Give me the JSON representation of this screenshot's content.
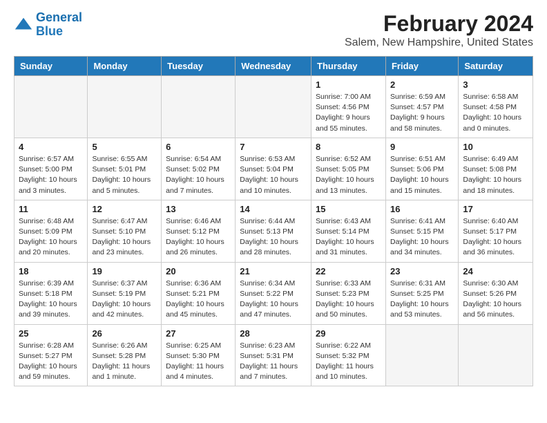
{
  "header": {
    "logo_line1": "General",
    "logo_line2": "Blue",
    "month": "February 2024",
    "location": "Salem, New Hampshire, United States"
  },
  "days_of_week": [
    "Sunday",
    "Monday",
    "Tuesday",
    "Wednesday",
    "Thursday",
    "Friday",
    "Saturday"
  ],
  "weeks": [
    [
      {
        "day": "",
        "info": ""
      },
      {
        "day": "",
        "info": ""
      },
      {
        "day": "",
        "info": ""
      },
      {
        "day": "",
        "info": ""
      },
      {
        "day": "1",
        "info": "Sunrise: 7:00 AM\nSunset: 4:56 PM\nDaylight: 9 hours and 55 minutes."
      },
      {
        "day": "2",
        "info": "Sunrise: 6:59 AM\nSunset: 4:57 PM\nDaylight: 9 hours and 58 minutes."
      },
      {
        "day": "3",
        "info": "Sunrise: 6:58 AM\nSunset: 4:58 PM\nDaylight: 10 hours and 0 minutes."
      }
    ],
    [
      {
        "day": "4",
        "info": "Sunrise: 6:57 AM\nSunset: 5:00 PM\nDaylight: 10 hours and 3 minutes."
      },
      {
        "day": "5",
        "info": "Sunrise: 6:55 AM\nSunset: 5:01 PM\nDaylight: 10 hours and 5 minutes."
      },
      {
        "day": "6",
        "info": "Sunrise: 6:54 AM\nSunset: 5:02 PM\nDaylight: 10 hours and 7 minutes."
      },
      {
        "day": "7",
        "info": "Sunrise: 6:53 AM\nSunset: 5:04 PM\nDaylight: 10 hours and 10 minutes."
      },
      {
        "day": "8",
        "info": "Sunrise: 6:52 AM\nSunset: 5:05 PM\nDaylight: 10 hours and 13 minutes."
      },
      {
        "day": "9",
        "info": "Sunrise: 6:51 AM\nSunset: 5:06 PM\nDaylight: 10 hours and 15 minutes."
      },
      {
        "day": "10",
        "info": "Sunrise: 6:49 AM\nSunset: 5:08 PM\nDaylight: 10 hours and 18 minutes."
      }
    ],
    [
      {
        "day": "11",
        "info": "Sunrise: 6:48 AM\nSunset: 5:09 PM\nDaylight: 10 hours and 20 minutes."
      },
      {
        "day": "12",
        "info": "Sunrise: 6:47 AM\nSunset: 5:10 PM\nDaylight: 10 hours and 23 minutes."
      },
      {
        "day": "13",
        "info": "Sunrise: 6:46 AM\nSunset: 5:12 PM\nDaylight: 10 hours and 26 minutes."
      },
      {
        "day": "14",
        "info": "Sunrise: 6:44 AM\nSunset: 5:13 PM\nDaylight: 10 hours and 28 minutes."
      },
      {
        "day": "15",
        "info": "Sunrise: 6:43 AM\nSunset: 5:14 PM\nDaylight: 10 hours and 31 minutes."
      },
      {
        "day": "16",
        "info": "Sunrise: 6:41 AM\nSunset: 5:15 PM\nDaylight: 10 hours and 34 minutes."
      },
      {
        "day": "17",
        "info": "Sunrise: 6:40 AM\nSunset: 5:17 PM\nDaylight: 10 hours and 36 minutes."
      }
    ],
    [
      {
        "day": "18",
        "info": "Sunrise: 6:39 AM\nSunset: 5:18 PM\nDaylight: 10 hours and 39 minutes."
      },
      {
        "day": "19",
        "info": "Sunrise: 6:37 AM\nSunset: 5:19 PM\nDaylight: 10 hours and 42 minutes."
      },
      {
        "day": "20",
        "info": "Sunrise: 6:36 AM\nSunset: 5:21 PM\nDaylight: 10 hours and 45 minutes."
      },
      {
        "day": "21",
        "info": "Sunrise: 6:34 AM\nSunset: 5:22 PM\nDaylight: 10 hours and 47 minutes."
      },
      {
        "day": "22",
        "info": "Sunrise: 6:33 AM\nSunset: 5:23 PM\nDaylight: 10 hours and 50 minutes."
      },
      {
        "day": "23",
        "info": "Sunrise: 6:31 AM\nSunset: 5:25 PM\nDaylight: 10 hours and 53 minutes."
      },
      {
        "day": "24",
        "info": "Sunrise: 6:30 AM\nSunset: 5:26 PM\nDaylight: 10 hours and 56 minutes."
      }
    ],
    [
      {
        "day": "25",
        "info": "Sunrise: 6:28 AM\nSunset: 5:27 PM\nDaylight: 10 hours and 59 minutes."
      },
      {
        "day": "26",
        "info": "Sunrise: 6:26 AM\nSunset: 5:28 PM\nDaylight: 11 hours and 1 minute."
      },
      {
        "day": "27",
        "info": "Sunrise: 6:25 AM\nSunset: 5:30 PM\nDaylight: 11 hours and 4 minutes."
      },
      {
        "day": "28",
        "info": "Sunrise: 6:23 AM\nSunset: 5:31 PM\nDaylight: 11 hours and 7 minutes."
      },
      {
        "day": "29",
        "info": "Sunrise: 6:22 AM\nSunset: 5:32 PM\nDaylight: 11 hours and 10 minutes."
      },
      {
        "day": "",
        "info": ""
      },
      {
        "day": "",
        "info": ""
      }
    ]
  ]
}
